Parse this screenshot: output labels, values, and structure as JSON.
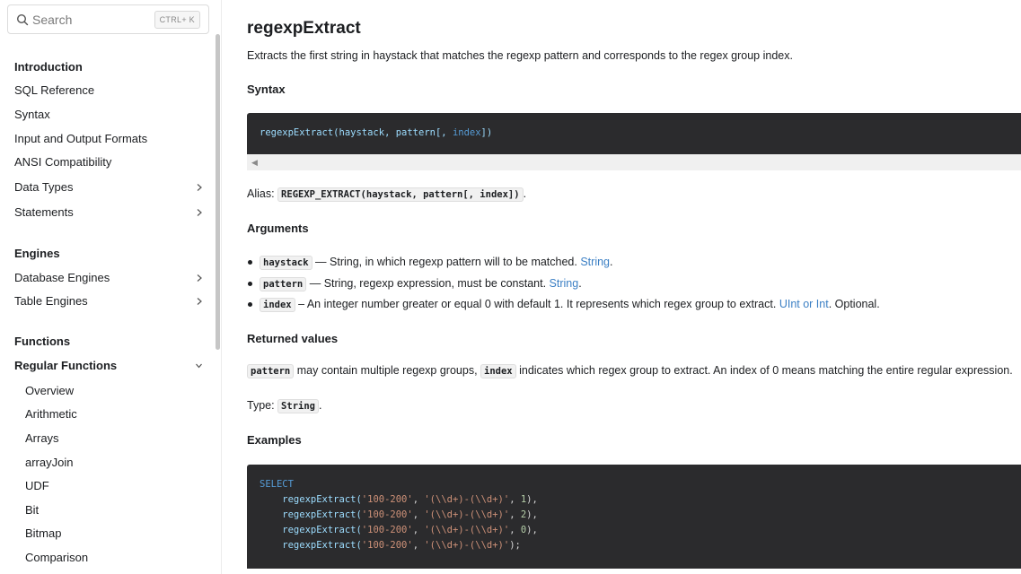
{
  "search": {
    "placeholder": "Search",
    "shortcut": "CTRL+ K"
  },
  "sidebar": {
    "introduction": "Introduction",
    "sql_reference": "SQL Reference",
    "syntax": "Syntax",
    "io_formats": "Input and Output Formats",
    "ansi": "ANSI Compatibility",
    "data_types": "Data Types",
    "statements": "Statements",
    "engines": "Engines",
    "database_engines": "Database Engines",
    "table_engines": "Table Engines",
    "functions": "Functions",
    "regular_functions": "Regular Functions",
    "sub_items": [
      "Overview",
      "Arithmetic",
      "Arrays",
      "arrayJoin",
      "UDF",
      "Bit",
      "Bitmap",
      "Comparison"
    ]
  },
  "doc": {
    "title": "regexpExtract",
    "description": "Extracts the first string in haystack that matches the regexp pattern and corresponds to the regex group index.",
    "syntax_heading": "Syntax",
    "syntax_code": {
      "fn": "regexpExtract(haystack, pattern[, ",
      "param": "index",
      "tail": "])"
    },
    "alias_label": "Alias: ",
    "alias_code": "REGEXP_EXTRACT(haystack, pattern[, index])",
    "alias_end": ".",
    "arguments_heading": "Arguments",
    "args": [
      {
        "name": "haystack",
        "text": " — String, in which regexp pattern will to be matched. ",
        "link": "String",
        "after": "."
      },
      {
        "name": "pattern",
        "text": " — String, regexp expression, must be constant. ",
        "link": "String",
        "after": "."
      },
      {
        "name": "index",
        "text": " – An integer number greater or equal 0 with default 1. It represents which regex group to extract. ",
        "link": "UInt or Int",
        "after": ". Optional."
      }
    ],
    "returned_heading": "Returned values",
    "returned_code1": "pattern",
    "returned_text1": " may contain multiple regexp groups, ",
    "returned_code2": "index",
    "returned_text2": " indicates which regex group to extract. An index of 0 means matching the entire regular expression.",
    "type_label": "Type: ",
    "type_code": "String",
    "type_end": ".",
    "examples_heading": "Examples",
    "example_select": "SELECT",
    "example_lines": [
      {
        "fn": "    regexpExtract(",
        "s1": "'100-200'",
        "c": ", ",
        "s2": "'(\\\\d+)-(\\\\d+)'",
        "c2": ", ",
        "n": "1",
        "end": "),",
        "has_num": true
      },
      {
        "fn": "    regexpExtract(",
        "s1": "'100-200'",
        "c": ", ",
        "s2": "'(\\\\d+)-(\\\\d+)'",
        "c2": ", ",
        "n": "2",
        "end": "),",
        "has_num": true
      },
      {
        "fn": "    regexpExtract(",
        "s1": "'100-200'",
        "c": ", ",
        "s2": "'(\\\\d+)-(\\\\d+)'",
        "c2": ", ",
        "n": "0",
        "end": "),",
        "has_num": true
      },
      {
        "fn": "    regexpExtract(",
        "s1": "'100-200'",
        "c": ", ",
        "s2": "'(\\\\d+)-(\\\\d+)'",
        "c2": "",
        "n": "",
        "end": ");",
        "has_num": false
      }
    ]
  },
  "colors": {
    "link": "#3b7fc4",
    "code_bg": "#2b2b2d",
    "keyword": "#569cd6",
    "string": "#ce9178"
  },
  "icons": {
    "search": "search-icon",
    "chevron_right": "chevron-right-icon",
    "chevron_down": "chevron-down-icon",
    "scroll_left": "arrow-left-icon"
  }
}
